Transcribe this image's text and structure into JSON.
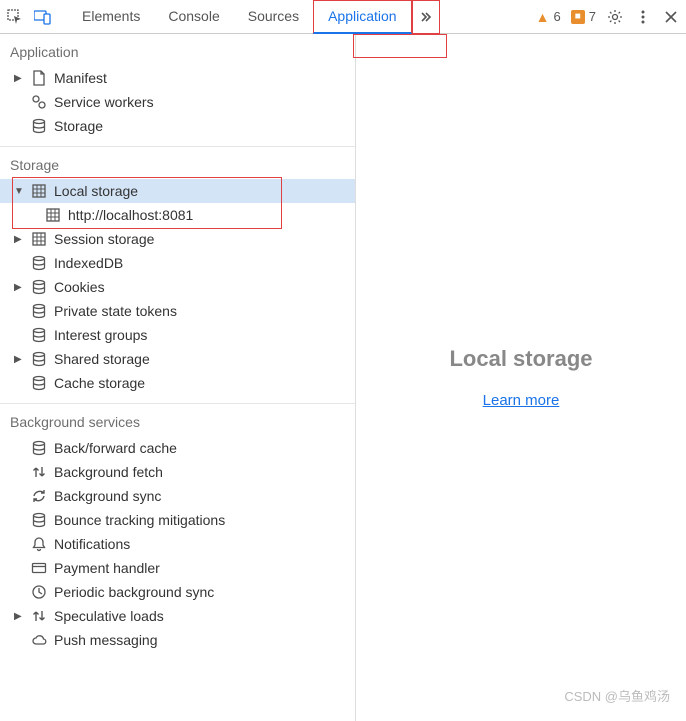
{
  "toolbar": {
    "tabs": [
      "Elements",
      "Console",
      "Sources",
      "Application"
    ],
    "activeTab": "Application",
    "warnings": "6",
    "issues": "7"
  },
  "sidebar": {
    "sections": [
      {
        "title": "Application",
        "items": [
          {
            "label": "Manifest",
            "icon": "file",
            "expandable": true
          },
          {
            "label": "Service workers",
            "icon": "gears"
          },
          {
            "label": "Storage",
            "icon": "db"
          }
        ]
      },
      {
        "title": "Storage",
        "items": [
          {
            "label": "Local storage",
            "icon": "grid",
            "expandable": true,
            "expanded": true,
            "selected": true,
            "children": [
              {
                "label": "http://localhost:8081",
                "icon": "grid"
              }
            ]
          },
          {
            "label": "Session storage",
            "icon": "grid",
            "expandable": true
          },
          {
            "label": "IndexedDB",
            "icon": "db"
          },
          {
            "label": "Cookies",
            "icon": "db",
            "expandable": true
          },
          {
            "label": "Private state tokens",
            "icon": "db"
          },
          {
            "label": "Interest groups",
            "icon": "db"
          },
          {
            "label": "Shared storage",
            "icon": "db",
            "expandable": true
          },
          {
            "label": "Cache storage",
            "icon": "db"
          }
        ]
      },
      {
        "title": "Background services",
        "items": [
          {
            "label": "Back/forward cache",
            "icon": "db"
          },
          {
            "label": "Background fetch",
            "icon": "updown"
          },
          {
            "label": "Background sync",
            "icon": "sync"
          },
          {
            "label": "Bounce tracking mitigations",
            "icon": "db"
          },
          {
            "label": "Notifications",
            "icon": "bell"
          },
          {
            "label": "Payment handler",
            "icon": "card"
          },
          {
            "label": "Periodic background sync",
            "icon": "clock"
          },
          {
            "label": "Speculative loads",
            "icon": "updown",
            "expandable": true
          },
          {
            "label": "Push messaging",
            "icon": "cloud"
          }
        ]
      }
    ]
  },
  "main": {
    "title": "Local storage",
    "link": "Learn more"
  },
  "watermark": "CSDN @乌鱼鸡汤"
}
